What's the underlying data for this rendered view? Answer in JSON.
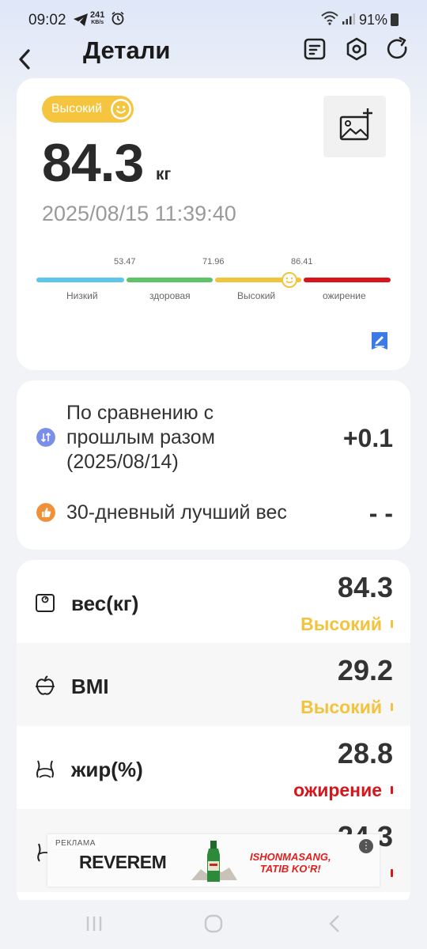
{
  "status_bar": {
    "time": "09:02",
    "speed_value": "241",
    "speed_unit": "KB/s",
    "battery": "91%"
  },
  "header": {
    "title": "Детали"
  },
  "summary": {
    "badge": "Высокий",
    "weight": "84.3",
    "unit": "кг",
    "datetime": "2025/08/15 11:39:40",
    "scale": {
      "thresholds": [
        "53.47",
        "71.96",
        "86.41"
      ],
      "segments": [
        {
          "label": "Низкий",
          "color": "#5ec6ec"
        },
        {
          "label": "здоровая",
          "color": "#5dc567"
        },
        {
          "label": "Высокий",
          "color": "#f2c33c"
        },
        {
          "label": "ожирение",
          "color": "#d7151b"
        }
      ]
    }
  },
  "comparison": {
    "previous_text": "По сравнению с прошлым разом (2025/08/14)",
    "previous_value": "+0.1",
    "best_text": "30-дневный лучший вес",
    "best_value": "- -"
  },
  "metrics": [
    {
      "label": "вес(кг)",
      "value": "84.3",
      "status": "Высокий",
      "status_color": "#f2c33c",
      "icon": "scale-icon"
    },
    {
      "label": "BMI",
      "value": "29.2",
      "status": "Высокий",
      "status_color": "#f2c33c",
      "icon": "apple-measure-icon"
    },
    {
      "label": "жир(%)",
      "value": "28.8",
      "status": "ожирение",
      "status_color": "#d7151b",
      "icon": "body-fat-icon"
    },
    {
      "label": "",
      "value": "24.3",
      "status": "",
      "status_color": "#d7151b",
      "icon": "body-icon"
    }
  ],
  "ad": {
    "label": "РЕКЛАМА",
    "brand": "REVEREM",
    "slogan_line1": "ISHONMASANG,",
    "slogan_line2": "TATIB KO‘R!"
  }
}
